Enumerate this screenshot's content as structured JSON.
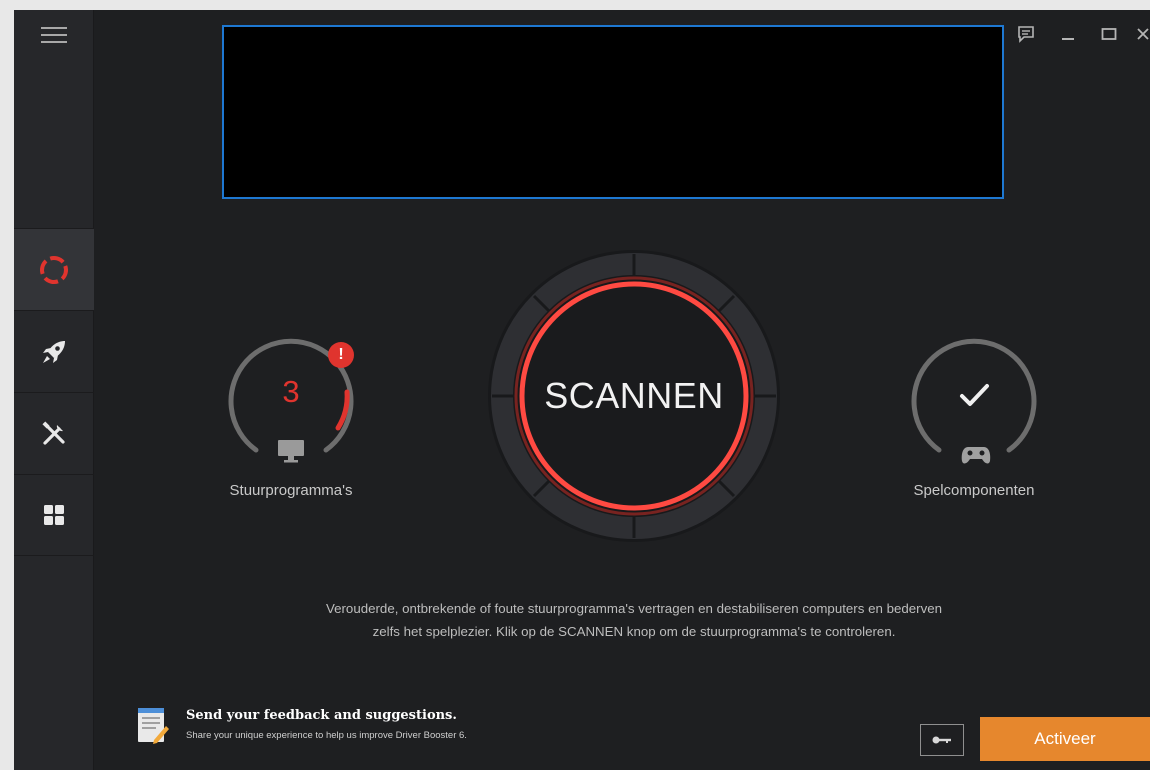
{
  "left_gauge": {
    "count": "3",
    "label": "Stuurprogramma's",
    "alert_badge": "!"
  },
  "right_gauge": {
    "label": "Spelcomponenten"
  },
  "scan_button": {
    "label": "SCANNEN"
  },
  "description": {
    "line1": "Verouderde, ontbrekende of foute stuurprogramma's vertragen en destabiliseren computers en bederven",
    "line2": "zelfs het spelplezier. Klik op de SCANNEN knop om de stuurprogramma's te controleren."
  },
  "feedback": {
    "title": "Send your feedback and suggestions.",
    "subtitle": "Share your unique experience to help us improve Driver Booster 6."
  },
  "footer": {
    "activate_label": "Activeer"
  },
  "icons": {
    "menu": "hamburger-icon",
    "nav": [
      "scan-lifebuoy-icon",
      "rocket-icon",
      "tools-icon",
      "grid-icon"
    ],
    "title_bar": [
      "chat-icon",
      "minimize-icon",
      "maximize-icon",
      "close-icon"
    ]
  },
  "colors": {
    "accent_red": "#e0342e",
    "activate_orange": "#e6872d",
    "banner_border": "#1e78d2"
  }
}
